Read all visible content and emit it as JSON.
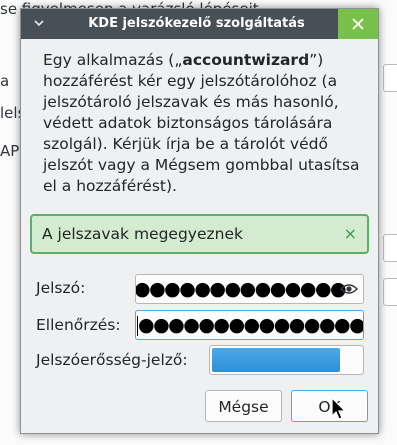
{
  "background": {
    "fragments": [
      "se figyelmesen a varázsló lépéseit",
      "a",
      "lels",
      "AP"
    ]
  },
  "dialog": {
    "title": "KDE jelszókezelő szolgáltatás",
    "message_before": "Egy alkalmazás („",
    "message_app": "accountwizard",
    "message_after": "”) hozzáférést kér egy jelszótárolóhoz (a jelszótároló jelszavak és más hasonló, védett adatok biztonságos tárolására szolgál). Kérjük írja be a tárolót védő jelszót vagy a Mégsem gombbal utasítsa el a hozzáférést).",
    "notice": {
      "text": "A jelszavak megegyeznek",
      "close_glyph": "×"
    },
    "password": {
      "label": "Jelszó:",
      "masked": "●●●●●●●●●●●●●●"
    },
    "confirm": {
      "label": "Ellenőrzés:",
      "masked": "●●●●●●●●●●●●●●●"
    },
    "strength": {
      "label": "Jelszóerősség-jelző:",
      "level": 0.86
    },
    "buttons": {
      "cancel": "Mégse",
      "ok": "OK"
    }
  },
  "icons": {
    "menu": "chevron-down-icon",
    "close": "close-icon",
    "eye": "eye-icon",
    "cursor": "mouse-pointer-icon"
  },
  "colors": {
    "titlebar": "#475057",
    "close": "#77c049",
    "accent": "#3daee9",
    "success_bg": "#d3ebcf",
    "success_border": "#5cae6b"
  }
}
